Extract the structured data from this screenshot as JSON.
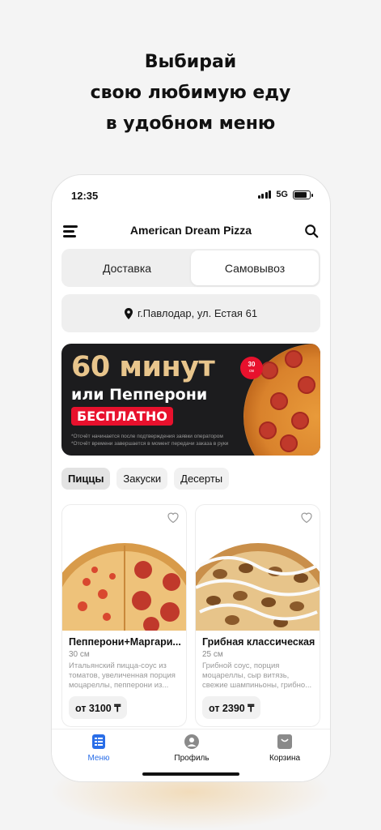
{
  "headline": {
    "line1": "Выбирай",
    "line2": "свою любимую еду",
    "line3": "в удобном меню"
  },
  "status_bar": {
    "time": "12:35",
    "network": "5G"
  },
  "app_bar": {
    "title": "American Dream Pizza",
    "menu_icon": "hamburger-icon",
    "search_icon": "search-icon"
  },
  "order_mode": {
    "options": [
      "Доставка",
      "Самовывоз"
    ],
    "selected": "Самовывоз"
  },
  "address": {
    "icon": "location-pin-icon",
    "text": "г.Павлодар, ул. Естая 61"
  },
  "promo_banner": {
    "line1": "60 минут",
    "line2": "или Пепперони",
    "line3": "БЕСПЛАТНО",
    "badge_value": "30",
    "badge_unit": "см",
    "fine_print_1": "*Отсчёт начинается после подтверждения заявки оператором",
    "fine_print_2": "*Отсчёт времени завершается в момент передачи заказа в руки"
  },
  "categories": [
    "Пиццы",
    "Закуски",
    "Десерты"
  ],
  "selected_category": "Пиццы",
  "products": [
    {
      "name": "Пепперони+Маргари...",
      "size": "30 см",
      "description": "Итальянский пицца-соус из томатов, увеличенная порция моцареллы, пепперони из...",
      "price": "от 3100 ₸"
    },
    {
      "name": "Грибная классическая",
      "size": "25 см",
      "description": "Грибной соус, порция моцареллы, сыр витязь, свежие шампиньоны, грибно...",
      "price": "от 2390 ₸"
    }
  ],
  "tab_bar": [
    {
      "label": "Меню",
      "icon": "menu-list-icon",
      "active": true
    },
    {
      "label": "Профиль",
      "icon": "profile-icon",
      "active": false
    },
    {
      "label": "Корзина",
      "icon": "cart-icon",
      "active": false
    }
  ],
  "colors": {
    "accent": "#2a6ee8",
    "promo_red": "#e8112d",
    "promo_gold": "#e8c58c",
    "banner_bg": "#1c1c1e"
  }
}
